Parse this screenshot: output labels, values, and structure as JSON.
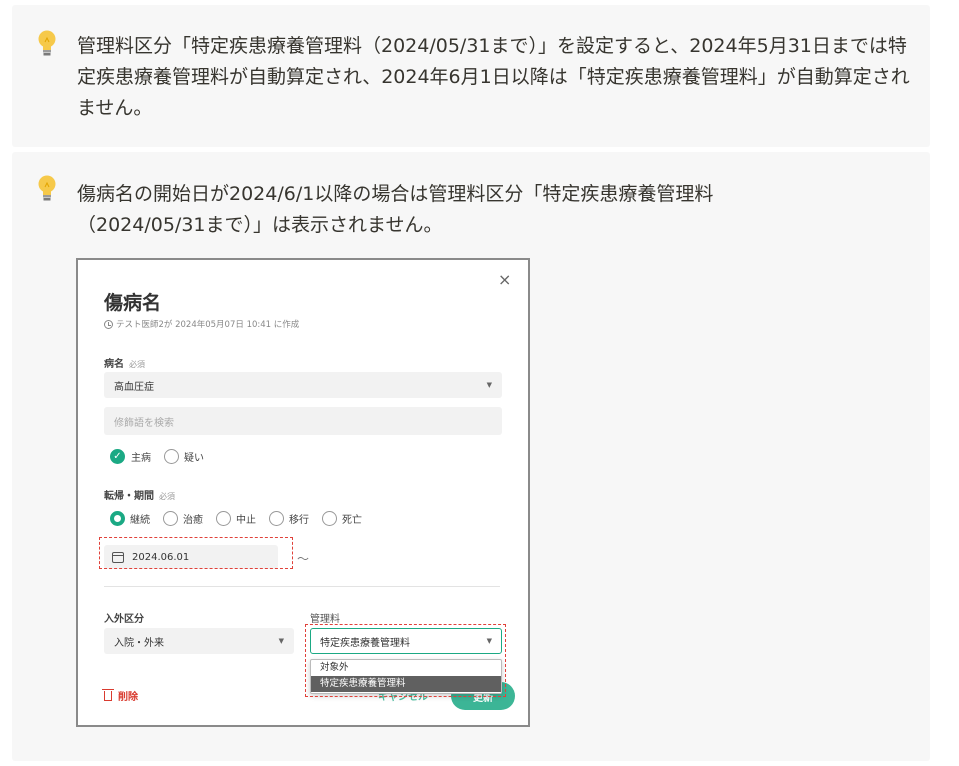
{
  "callouts": [
    {
      "icon": "lightbulb-icon",
      "text": "管理料区分「特定疾患療養管理料（2024/05/31まで）」を設定すると、2024年5月31日までは特定疾患療養管理料が自動算定され、2024年6月1日以降は「特定疾患療養管理料」が自動算定されません。"
    },
    {
      "icon": "lightbulb-icon",
      "text": "傷病名の開始日が2024/6/1以降の場合は管理料区分「特定疾患療養管理料（2024/05/31まで）」は表示されません。"
    }
  ],
  "dialog": {
    "close": "×",
    "title": "傷病名",
    "meta": "テスト医師2が 2024年05月07日 10:41 に作成",
    "disease_label": "病名",
    "required": "必須",
    "disease_value": "高血圧症",
    "modifier_placeholder": "修飾語を検索",
    "check_main": "主病",
    "check_suspect": "疑い",
    "outcome_label": "転帰・期間",
    "outcome_required": "必須",
    "outcomes": [
      "継続",
      "治癒",
      "中止",
      "移行",
      "死亡"
    ],
    "start_date": "2024.06.01",
    "tilde": "〜",
    "inout_label": "入外区分",
    "inout_value": "入院・外来",
    "mgmt_label": "管理料",
    "mgmt_value": "特定疾患療養管理料",
    "mgmt_options": [
      "対象外",
      "特定疾患療養管理料"
    ],
    "delete": "削除",
    "cancel": "キャンセル",
    "update": "更新"
  },
  "colors": {
    "accent": "#1ba984",
    "danger": "#d93b2f",
    "callout_bg": "#f7f7f7",
    "highlight_dash": "#e0413a"
  }
}
